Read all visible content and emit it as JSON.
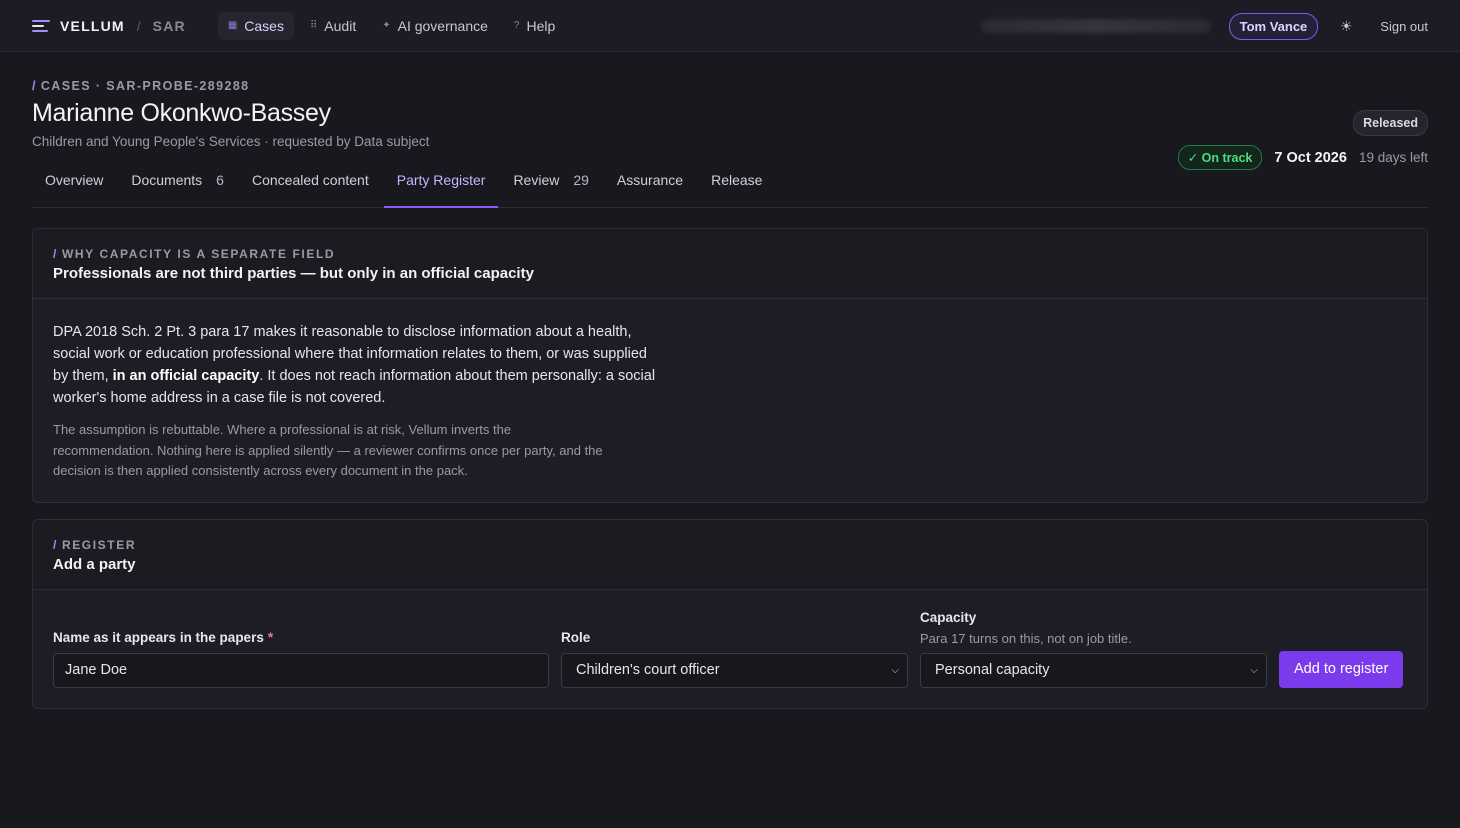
{
  "app": {
    "brand": "VELLUM",
    "sub": "SAR"
  },
  "nav": {
    "items": [
      {
        "label": "Cases",
        "icon": "▦"
      },
      {
        "label": "Audit",
        "icon": "⠿"
      },
      {
        "label": "AI governance",
        "icon": "✦"
      },
      {
        "label": "Help",
        "icon": "?"
      }
    ]
  },
  "user": {
    "name": "Tom Vance",
    "signout": "Sign out"
  },
  "header": {
    "breadcrumb": "CASES · SAR-PROBE-289288",
    "title": "Marianne Okonkwo-Bassey",
    "subtitle": "Children and Young People's Services · requested by Data subject",
    "status": "Released",
    "track": "On track",
    "due_date": "7 Oct 2026",
    "days_left": "19 days left"
  },
  "tabs": [
    {
      "label": "Overview",
      "count": ""
    },
    {
      "label": "Documents",
      "count": "6"
    },
    {
      "label": "Concealed content",
      "count": ""
    },
    {
      "label": "Party Register",
      "count": ""
    },
    {
      "label": "Review",
      "count": "29"
    },
    {
      "label": "Assurance",
      "count": ""
    },
    {
      "label": "Release",
      "count": ""
    }
  ],
  "capacity_card": {
    "kicker": "WHY CAPACITY IS A SEPARATE FIELD",
    "title": "Professionals are not third parties — but only in an official capacity",
    "para1_before": "DPA 2018 Sch. 2 Pt. 3 para 17 makes it reasonable to disclose information about a health, social work or education professional where that information relates to them, or was supplied by them, ",
    "para1_bold": "in an official capacity",
    "para1_after": ". It does not reach information about them personally: a social worker's home address in a case file is not covered.",
    "para2": "The assumption is rebuttable. Where a professional is at risk, Vellum inverts the recommendation. Nothing here is applied silently — a reviewer confirms once per party, and the decision is then applied consistently across every document in the pack."
  },
  "register_card": {
    "kicker": "REGISTER",
    "title": "Add a party",
    "name_label": "Name as it appears in the papers",
    "required_mark": "*",
    "name_value": "Jane Doe",
    "role_label": "Role",
    "role_value": "Children's court officer",
    "capacity_label": "Capacity",
    "capacity_hint": "Para 17 turns on this, not on job title.",
    "capacity_value": "Personal capacity",
    "submit_label": "Add to register"
  }
}
